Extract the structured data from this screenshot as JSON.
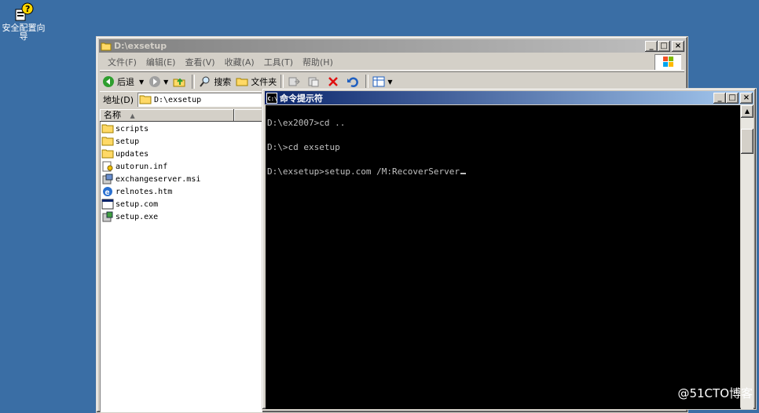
{
  "desktop": {
    "icon_label": "安全配置向导"
  },
  "explorer": {
    "title": "D:\\exsetup",
    "menu": [
      "文件(F)",
      "编辑(E)",
      "查看(V)",
      "收藏(A)",
      "工具(T)",
      "帮助(H)"
    ],
    "toolbar": {
      "back": "后退",
      "search": "搜索",
      "folders": "文件夹"
    },
    "address_label": "地址(D)",
    "address_value": "D:\\exsetup",
    "column_name": "名称",
    "files": [
      {
        "name": "scripts",
        "icon": "folder-icon"
      },
      {
        "name": "setup",
        "icon": "folder-icon"
      },
      {
        "name": "updates",
        "icon": "folder-icon"
      },
      {
        "name": "autorun.inf",
        "icon": "settings-file-icon"
      },
      {
        "name": "exchangeserver.msi",
        "icon": "installer-icon"
      },
      {
        "name": "relnotes.htm",
        "icon": "ie-document-icon"
      },
      {
        "name": "setup.com",
        "icon": "console-app-icon"
      },
      {
        "name": "setup.exe",
        "icon": "setup-exe-icon"
      }
    ]
  },
  "console": {
    "title": "命令提示符",
    "lines": [
      "D:\\ex2007>cd ..",
      "D:\\>cd exsetup",
      "D:\\exsetup>setup.com /M:RecoverServer"
    ]
  },
  "watermark": "@51CTO博客",
  "colors": {
    "desktop": "#3a6ea5",
    "active_title": "#0a246a",
    "inactive_title": "#808080",
    "console_bg": "#000000",
    "console_fg": "#c0c0c0"
  }
}
